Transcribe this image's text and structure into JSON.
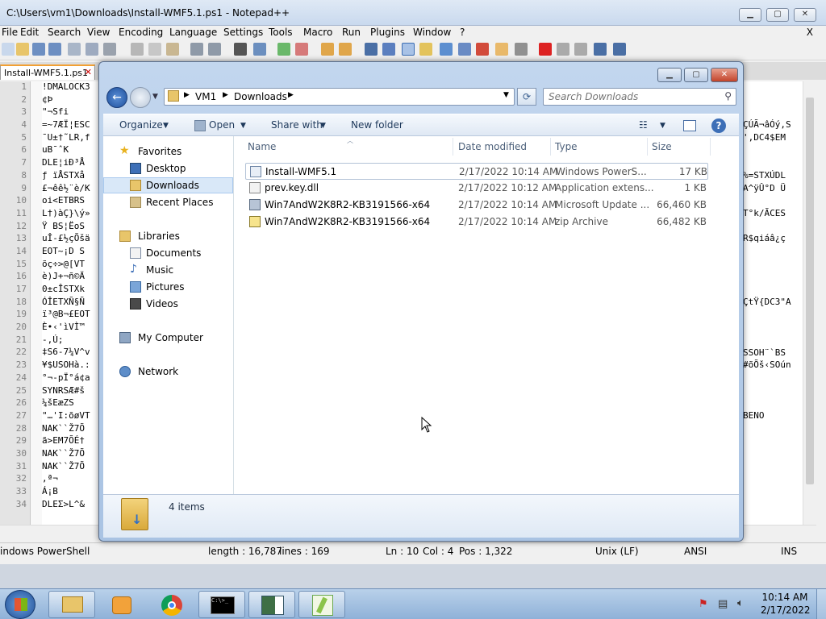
{
  "notepad": {
    "title": "C:\\Users\\vm1\\Downloads\\Install-WMF5.1.ps1 - Notepad++",
    "minimize": "▁",
    "maximize": "▢",
    "close": "✕",
    "menu": [
      "File",
      "Edit",
      "Search",
      "View",
      "Encoding",
      "Language",
      "Settings",
      "Tools",
      "Macro",
      "Run",
      "Plugins",
      "Window",
      "?"
    ],
    "menu_close": "X",
    "tab_label": "Install-WMF5.1.ps1",
    "tab_close": "✕",
    "line_numbers": [
      "1",
      "2",
      "3",
      "4",
      "5",
      "6",
      "7",
      "8",
      "9",
      "10",
      "11",
      "12",
      "13",
      "14",
      "15",
      "16",
      "17",
      "18",
      "19",
      "20",
      "21",
      "22",
      "23",
      "24",
      "25",
      "26",
      "27",
      "28",
      "29",
      "30",
      "31",
      "32",
      "33",
      "34"
    ],
    "code_left": [
      "!DMALOCK3",
      "¢Þ",
      "\"¬Sfi",
      "=~7ÆÏ¦ESC",
      "¯U±†˜LR,f",
      "uB¯ˆK",
      "DLE¦iÐ³Å",
      "ƒ ïÅSTXå",
      "£¬êê½¨è/K",
      "oi<ETBRS",
      "L†)àÇ}\\ý»",
      "Ÿ BS¦ËoS",
      "uÎ-£½çÕšä",
      "EOT~¡D S",
      "õç÷>@[VT",
      "è)J+¬ñ©Ä",
      "0±cÎSTXk",
      "ÓÎETXÑ§Ñ",
      "ï³@B¬£EOT",
      "È•‹'ìVÌ™",
      "-,Ú;",
      "‡S6-7¼V^v",
      "¥$USOHà.:",
      "°¬-pÏ°á¢a",
      "SYNRSÆ#š",
      "¼šEæZS",
      "\"…'I:õøVT",
      "NAK``Ž7Õ",
      "ã>EM7ÕÉ†",
      "NAK``Ž7Õ",
      "NAK``Ž7Õ",
      ",ª¬",
      "Á¡B",
      "DLEƩ>L^&"
    ],
    "code_right": [
      "ÇÚÃ¬âÓý,S",
      "',DC4$EM",
      "%=STXÚDL",
      "A^ÿÛ°D Ü",
      "T°k/ÃCES",
      "R$qiáâ¿ç",
      "ÇtŸ{DC3\"A",
      "SSOH¨`BS",
      "#õÕš‹SOún",
      "BENO"
    ],
    "status_type": "indows PowerShell",
    "status_length": "length : 16,787",
    "status_lines": "lines : 169",
    "status_ln": "Ln : 10",
    "status_col": "Col : 4",
    "status_pos": "Pos : 1,322",
    "status_eol": "Unix (LF)",
    "status_enc": "ANSI",
    "status_ins": "INS"
  },
  "explorer": {
    "minimize": "▁",
    "maximize": "▢",
    "close": "✕",
    "breadcrumb": [
      "VM1",
      "Downloads"
    ],
    "search_placeholder": "Search Downloads",
    "commands": {
      "organize": "Organize",
      "open": "Open",
      "share_with": "Share with",
      "new_folder": "New folder"
    },
    "nav": {
      "favorites": "Favorites",
      "desktop": "Desktop",
      "downloads": "Downloads",
      "recent_places": "Recent Places",
      "libraries": "Libraries",
      "documents": "Documents",
      "music": "Music",
      "pictures": "Pictures",
      "videos": "Videos",
      "my_computer": "My Computer",
      "network": "Network"
    },
    "columns": {
      "name": "Name",
      "date_modified": "Date modified",
      "type": "Type",
      "size": "Size"
    },
    "files": [
      {
        "name": "Install-WMF5.1",
        "date": "2/17/2022 10:14 AM",
        "type": "Windows PowerS...",
        "size": "17 KB"
      },
      {
        "name": "prev.key.dll",
        "date": "2/17/2022 10:12 AM",
        "type": "Application extens...",
        "size": "1 KB"
      },
      {
        "name": "Win7AndW2K8R2-KB3191566-x64",
        "date": "2/17/2022 10:14 AM",
        "type": "Microsoft Update ...",
        "size": "66,460 KB"
      },
      {
        "name": "Win7AndW2K8R2-KB3191566-x64",
        "date": "2/17/2022 10:14 AM",
        "type": "zip Archive",
        "size": "66,482 KB"
      }
    ],
    "item_count": "4 items"
  },
  "taskbar": {
    "time": "10:14 AM",
    "date": "2/17/2022"
  }
}
